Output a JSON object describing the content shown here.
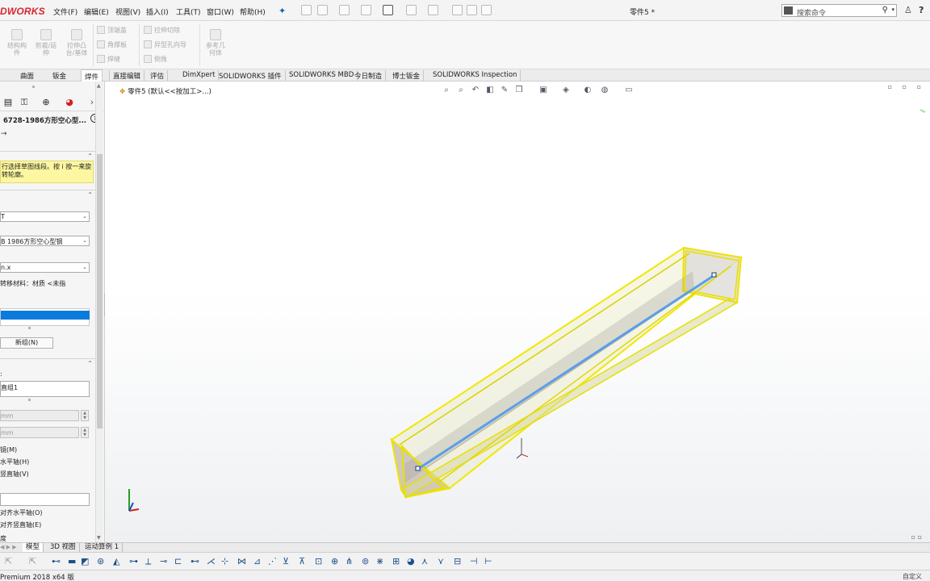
{
  "app": {
    "logo_text": "DWORKS",
    "document_title": "零件5 *",
    "version_status": "Premium 2018 x64 版"
  },
  "menu": {
    "items": [
      "文件(F)",
      "编辑(E)",
      "视图(V)",
      "插入(I)",
      "工具(T)",
      "窗口(W)",
      "帮助(H)"
    ]
  },
  "search": {
    "placeholder": "搜索命令"
  },
  "ribbon": {
    "big_buttons": [
      "结构构件",
      "剪裁/延伸",
      "拉伸凸台/基体",
      "参考几何体"
    ],
    "small_buttons": [
      "顶端盖",
      "角撑板",
      "焊缝",
      "拉伸切除",
      "异型孔向导",
      "倒角"
    ]
  },
  "panel_tabs": {
    "items": [
      "",
      "曲面",
      "钣金",
      "焊件"
    ],
    "active": "焊件"
  },
  "command_tabs": {
    "items": [
      "直接编辑",
      "评估",
      "DimXpert",
      "SOLIDWORKS 插件",
      "SOLIDWORKS MBD",
      "今日制造",
      "博士钣金",
      "SOLIDWORKS Inspection"
    ]
  },
  "property_manager": {
    "title": "6728-1986方形空心型...",
    "message": "行选择草图线段。按 i 按一来旋转轮廓。",
    "standard_value": "T",
    "type_value": "B 1986方形空心型钢",
    "size_value": "n.x",
    "transfer_material_label": "转移材料：材质 <未指",
    "new_group_button": "新组(N)",
    "group_name_value": "直组1",
    "spin1_value": "mm",
    "spin2_value": "mm",
    "option_mirror": "镜(M)",
    "option_horizontal": "水平轴(H)",
    "option_vertical": "竖直轴(V)",
    "option_align_horizontal": "对齐水平轴(O)",
    "option_align_vertical": "对齐竖直轴(E)",
    "bottom_label": "度"
  },
  "graphics": {
    "tree_crumb": "零件5 (默认<<按加工>...)",
    "heads_up_icons": [
      "zoom-to-fit-icon",
      "zoom-area-icon",
      "previous-view-icon",
      "section-view-icon",
      "dynamic-annotation-icon",
      "view-orientation-icon",
      "display-style-icon",
      "hide-show-icon",
      "appearance-icon",
      "scene-icon",
      "view-settings-icon"
    ],
    "selection_color": "#f5f000",
    "path_color": "#5a9ee8"
  },
  "model_tabs": {
    "items": [
      "模型",
      "3D 视图",
      "运动算例 1"
    ],
    "active": "模型"
  },
  "status": {
    "right_text": "自定义"
  }
}
